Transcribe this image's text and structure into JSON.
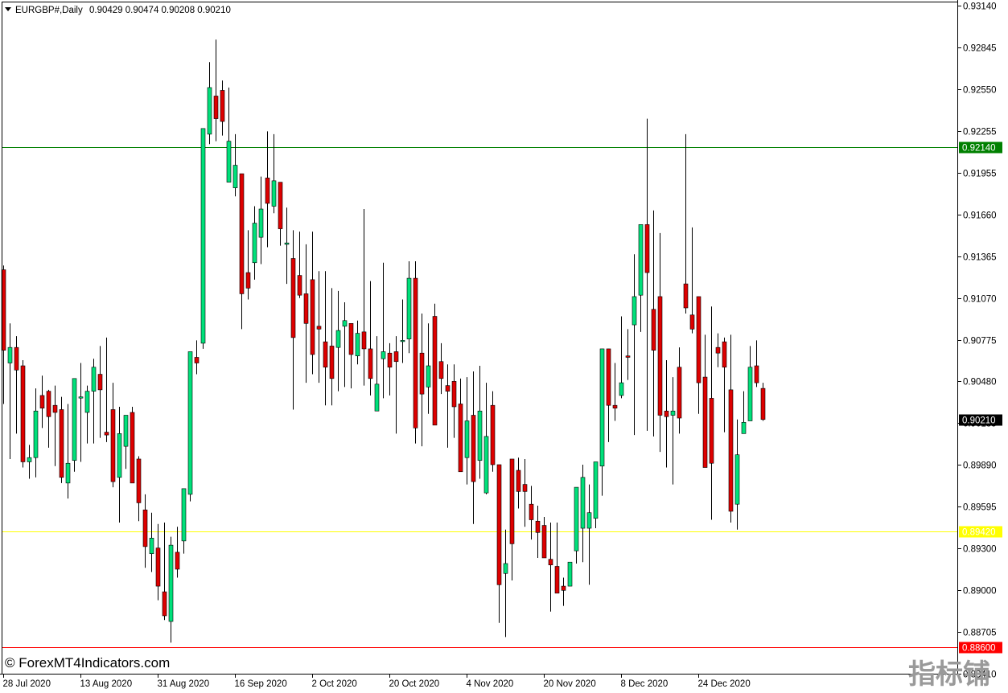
{
  "header": {
    "symbol": "EURGBP#,Daily",
    "ohlc": "0.90429 0.90474 0.90208 0.90210"
  },
  "watermark": "© ForexMT4Indicators.com",
  "corner_logo": "指标铺",
  "colors": {
    "bull": "#00e07a",
    "bear": "#dd0000",
    "wick": "#000000",
    "resistance": "#008000",
    "support_mid": "#ffff00",
    "support_low": "#ff0000",
    "price_tag": "#000000"
  },
  "chart_data": {
    "type": "candlestick",
    "symbol": "EURGBP#",
    "timeframe": "Daily",
    "ylim": [
      0.8841,
      0.9318
    ],
    "y_ticks": [
      "0.93140",
      "0.92845",
      "0.92550",
      "0.92255",
      "0.91955",
      "0.91660",
      "0.91365",
      "0.91070",
      "0.90775",
      "0.90480",
      "0.90185",
      "0.89890",
      "0.89595",
      "0.89300",
      "0.89000",
      "0.88705",
      "0.88410"
    ],
    "x_ticks": [
      {
        "label": "28 Jul 2020",
        "index": 0
      },
      {
        "label": "13 Aug 2020",
        "index": 12
      },
      {
        "label": "31 Aug 2020",
        "index": 24
      },
      {
        "label": "16 Sep 2020",
        "index": 36
      },
      {
        "label": "2 Oct 2020",
        "index": 48
      },
      {
        "label": "20 Oct 2020",
        "index": 60
      },
      {
        "label": "4 Nov 2020",
        "index": 72
      },
      {
        "label": "20 Nov 2020",
        "index": 84
      },
      {
        "label": "8 Dec 2020",
        "index": 96
      },
      {
        "label": "24 Dec 2020",
        "index": 108
      }
    ],
    "horizontal_lines": [
      {
        "price": 0.9214,
        "label": "0.92140",
        "role": "resistance"
      },
      {
        "price": 0.8942,
        "label": "0.89420",
        "role": "support_mid"
      },
      {
        "price": 0.886,
        "label": "0.88600",
        "role": "support_low"
      }
    ],
    "current_price": {
      "price": 0.9021,
      "label": "0.90210"
    },
    "candles": [
      [
        0.9127,
        0.913,
        0.9032,
        0.907
      ],
      [
        0.9061,
        0.9089,
        0.8993,
        0.9072
      ],
      [
        0.9072,
        0.908,
        0.9011,
        0.9056
      ],
      [
        0.9059,
        0.9063,
        0.8987,
        0.8991
      ],
      [
        0.8991,
        0.9003,
        0.8979,
        0.8994
      ],
      [
        0.8994,
        0.9043,
        0.898,
        0.9027
      ],
      [
        0.9038,
        0.9052,
        0.9015,
        0.9029
      ],
      [
        0.9041,
        0.9042,
        0.9001,
        0.9023
      ],
      [
        0.9031,
        0.9045,
        0.8988,
        0.9026
      ],
      [
        0.9028,
        0.9037,
        0.8976,
        0.898
      ],
      [
        0.8976,
        0.9032,
        0.8965,
        0.899
      ],
      [
        0.8992,
        0.904,
        0.8984,
        0.905
      ],
      [
        0.9037,
        0.9061,
        0.8991,
        0.9037
      ],
      [
        0.9026,
        0.9045,
        0.9004,
        0.9041
      ],
      [
        0.9041,
        0.9064,
        0.9004,
        0.9058
      ],
      [
        0.9053,
        0.9073,
        0.9008,
        0.9042
      ],
      [
        0.9012,
        0.9079,
        0.9005,
        0.901
      ],
      [
        0.9028,
        0.9047,
        0.8973,
        0.8977
      ],
      [
        0.898,
        0.903,
        0.8948,
        0.9011
      ],
      [
        0.9002,
        0.9014,
        0.8986,
        0.9024
      ],
      [
        0.9026,
        0.903,
        0.8979,
        0.8976
      ],
      [
        0.8993,
        0.8995,
        0.8949,
        0.8962
      ],
      [
        0.8957,
        0.8968,
        0.8916,
        0.8931
      ],
      [
        0.8926,
        0.8955,
        0.8913,
        0.8937
      ],
      [
        0.893,
        0.8947,
        0.8893,
        0.8903
      ],
      [
        0.8899,
        0.8948,
        0.8879,
        0.8882
      ],
      [
        0.8878,
        0.8938,
        0.8863,
        0.8932
      ],
      [
        0.8927,
        0.8945,
        0.8909,
        0.8915
      ],
      [
        0.8935,
        0.8968,
        0.8926,
        0.8972
      ],
      [
        0.8968,
        0.9012,
        0.8963,
        0.9069
      ],
      [
        0.9065,
        0.9077,
        0.9053,
        0.9061
      ],
      [
        0.9075,
        0.9136,
        0.9071,
        0.9227
      ],
      [
        0.9223,
        0.9274,
        0.9216,
        0.9256
      ],
      [
        0.925,
        0.929,
        0.9218,
        0.9234
      ],
      [
        0.9254,
        0.9261,
        0.9222,
        0.9232
      ],
      [
        0.9189,
        0.9256,
        0.919,
        0.9218
      ],
      [
        0.9185,
        0.9223,
        0.9179,
        0.9201
      ],
      [
        0.9195,
        0.917,
        0.9085,
        0.911
      ],
      [
        0.9125,
        0.9155,
        0.9106,
        0.9114
      ],
      [
        0.9132,
        0.9172,
        0.912,
        0.916
      ],
      [
        0.915,
        0.9193,
        0.9131,
        0.917
      ],
      [
        0.9192,
        0.9225,
        0.9143,
        0.9174
      ],
      [
        0.9172,
        0.9223,
        0.9167,
        0.919
      ],
      [
        0.9189,
        0.9172,
        0.9144,
        0.9156
      ],
      [
        0.9145,
        0.9171,
        0.9117,
        0.9146
      ],
      [
        0.9135,
        0.9155,
        0.9028,
        0.9079
      ],
      [
        0.9123,
        0.9154,
        0.9107,
        0.9109
      ],
      [
        0.911,
        0.9145,
        0.9047,
        0.9089
      ],
      [
        0.912,
        0.9154,
        0.9053,
        0.9067
      ],
      [
        0.9087,
        0.9126,
        0.9047,
        0.9085
      ],
      [
        0.9076,
        0.9126,
        0.9031,
        0.9058
      ],
      [
        0.9073,
        0.9114,
        0.9031,
        0.905
      ],
      [
        0.9072,
        0.9112,
        0.9041,
        0.9084
      ],
      [
        0.9087,
        0.9104,
        0.9044,
        0.9091
      ],
      [
        0.9089,
        0.9081,
        0.9043,
        0.9067
      ],
      [
        0.9066,
        0.9091,
        0.906,
        0.9082
      ],
      [
        0.9083,
        0.917,
        0.9045,
        0.9071
      ],
      [
        0.9071,
        0.9119,
        0.9038,
        0.905
      ],
      [
        0.9027,
        0.908,
        0.9031,
        0.9046
      ],
      [
        0.9064,
        0.9132,
        0.9036,
        0.9069
      ],
      [
        0.9068,
        0.9075,
        0.9038,
        0.9058
      ],
      [
        0.9069,
        0.908,
        0.9011,
        0.9062
      ],
      [
        0.9077,
        0.9106,
        0.9061,
        0.9077
      ],
      [
        0.9078,
        0.9133,
        0.9068,
        0.9121
      ],
      [
        0.9121,
        0.9133,
        0.9004,
        0.9015
      ],
      [
        0.9068,
        0.9096,
        0.9002,
        0.9039
      ],
      [
        0.9044,
        0.9089,
        0.9025,
        0.9059
      ],
      [
        0.9094,
        0.9103,
        0.902,
        0.9017
      ],
      [
        0.9062,
        0.9075,
        0.9039,
        0.905
      ],
      [
        0.9045,
        0.906,
        0.9001,
        0.9041
      ],
      [
        0.9048,
        0.906,
        0.9008,
        0.903
      ],
      [
        0.9032,
        0.905,
        0.8985,
        0.8984
      ],
      [
        0.8994,
        0.9051,
        0.8975,
        0.902
      ],
      [
        0.9024,
        0.9055,
        0.8947,
        0.8977
      ],
      [
        0.8992,
        0.9059,
        0.8979,
        0.9027
      ],
      [
        0.8969,
        0.9047,
        0.8968,
        0.9009
      ],
      [
        0.9031,
        0.9041,
        0.8984,
        0.8989
      ],
      [
        0.8989,
        0.8955,
        0.8877,
        0.8904
      ],
      [
        0.8912,
        0.8943,
        0.8867,
        0.8919
      ],
      [
        0.8993,
        0.8931,
        0.8907,
        0.8933
      ],
      [
        0.8985,
        0.8994,
        0.8958,
        0.897
      ],
      [
        0.8975,
        0.8993,
        0.8945,
        0.897
      ],
      [
        0.8961,
        0.8974,
        0.8936,
        0.895
      ],
      [
        0.8949,
        0.896,
        0.8923,
        0.8941
      ],
      [
        0.8946,
        0.8952,
        0.8926,
        0.8923
      ],
      [
        0.8922,
        0.8948,
        0.8885,
        0.8918
      ],
      [
        0.8917,
        0.8948,
        0.8898,
        0.8898
      ],
      [
        0.8903,
        0.8909,
        0.8889,
        0.89
      ],
      [
        0.8903,
        0.891,
        0.8908,
        0.892
      ],
      [
        0.8928,
        0.8964,
        0.8919,
        0.8973
      ],
      [
        0.8944,
        0.8989,
        0.892,
        0.898
      ],
      [
        0.8944,
        0.8975,
        0.8904,
        0.8955
      ],
      [
        0.8951,
        0.8989,
        0.8944,
        0.8991
      ],
      [
        0.8988,
        0.9043,
        0.8967,
        0.9071
      ],
      [
        0.9071,
        0.9059,
        0.9005,
        0.9031
      ],
      [
        0.9031,
        0.9061,
        0.902,
        0.9029
      ],
      [
        0.9038,
        0.9094,
        0.9036,
        0.9047
      ],
      [
        0.9066,
        0.9085,
        0.9049,
        0.9065
      ],
      [
        0.9088,
        0.9138,
        0.901,
        0.9108
      ],
      [
        0.9109,
        0.915,
        0.9083,
        0.9159
      ],
      [
        0.9159,
        0.9234,
        0.9013,
        0.9125
      ],
      [
        0.9099,
        0.9169,
        0.9009,
        0.907
      ],
      [
        0.9108,
        0.9153,
        0.8998,
        0.9024
      ],
      [
        0.9027,
        0.9063,
        0.8987,
        0.9023
      ],
      [
        0.9024,
        0.9051,
        0.8975,
        0.9027
      ],
      [
        0.9058,
        0.9072,
        0.9011,
        0.9022
      ],
      [
        0.9117,
        0.9223,
        0.9096,
        0.91
      ],
      [
        0.9095,
        0.9157,
        0.9082,
        0.9085
      ],
      [
        0.9108,
        0.9107,
        0.9025,
        0.9047
      ],
      [
        0.9051,
        0.9081,
        0.8992,
        0.8987
      ],
      [
        0.9036,
        0.9101,
        0.895,
        0.899
      ],
      [
        0.9072,
        0.9082,
        0.9058,
        0.9068
      ],
      [
        0.9076,
        0.9079,
        0.9012,
        0.9058
      ],
      [
        0.9042,
        0.9081,
        0.8948,
        0.8956
      ],
      [
        0.8961,
        0.9021,
        0.8943,
        0.8996
      ],
      [
        0.9011,
        0.9041,
        0.9017,
        0.9019
      ],
      [
        0.902,
        0.9073,
        0.9023,
        0.9058
      ],
      [
        0.9059,
        0.9077,
        0.9044,
        0.9047
      ],
      [
        0.9043,
        0.9047,
        0.902,
        0.9021
      ]
    ]
  }
}
